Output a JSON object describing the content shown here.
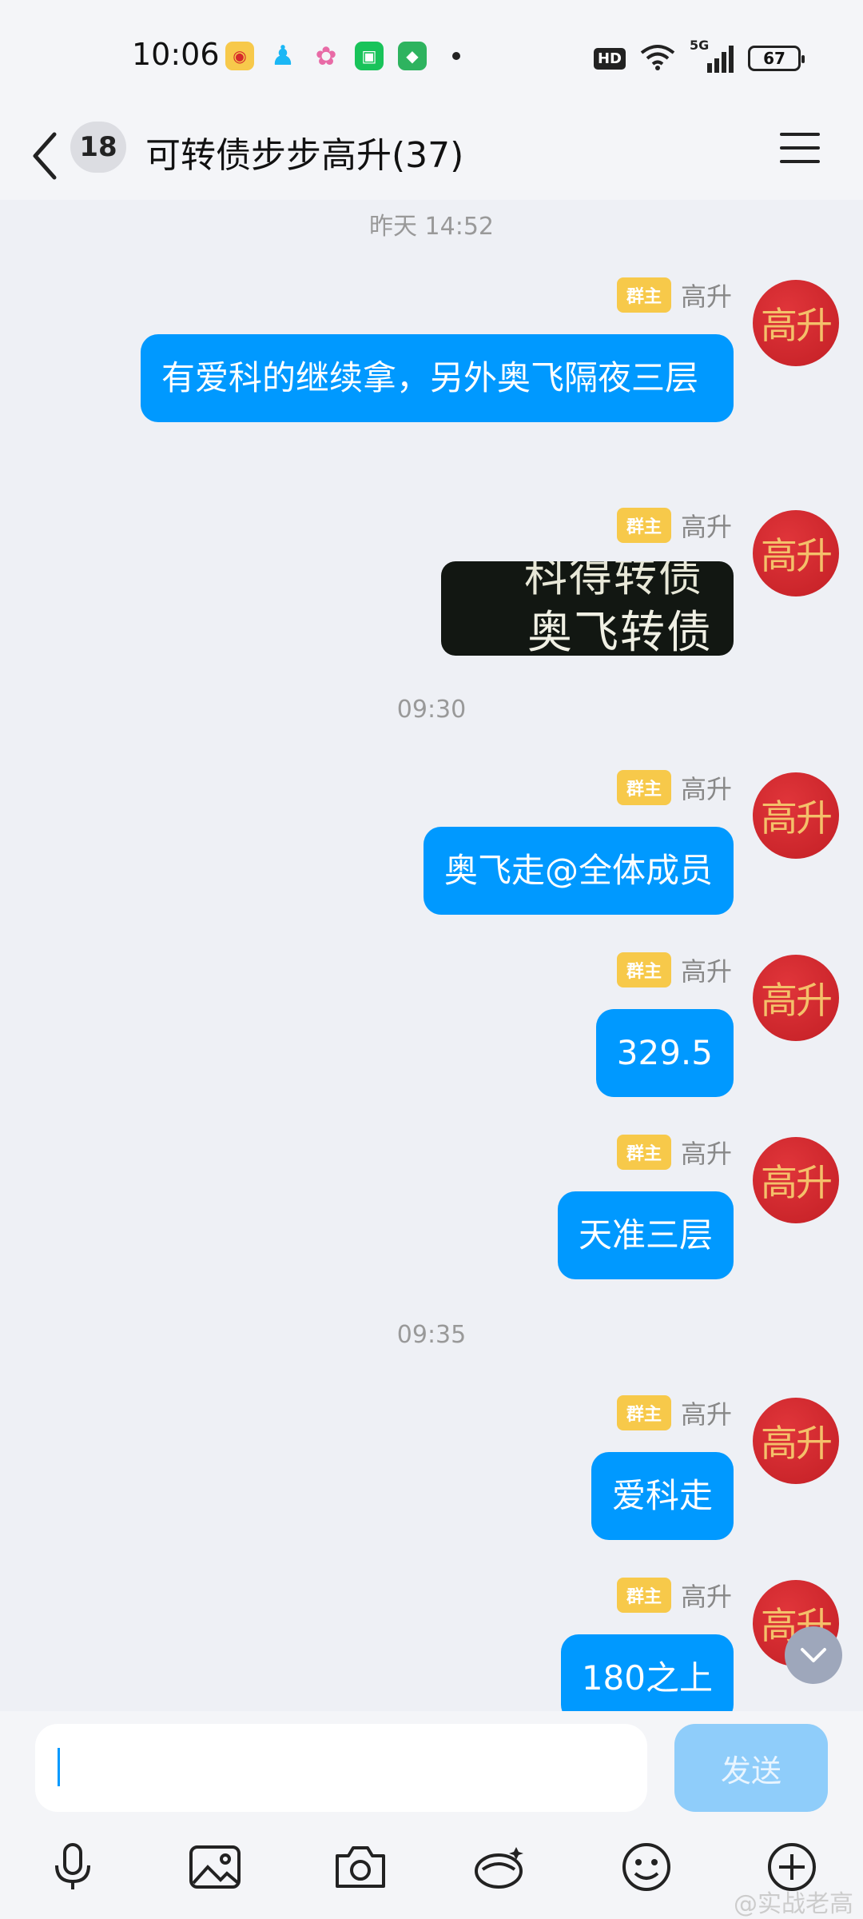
{
  "status_bar": {
    "time": "10:06",
    "hd_label": "HD",
    "signal_label": "5G",
    "battery_level": "67",
    "icons": [
      "weibo-icon",
      "qq-icon",
      "app-icon",
      "green-app-icon",
      "shield-icon",
      "notification-dot-icon",
      "wifi-icon",
      "signal-icon",
      "battery-icon"
    ]
  },
  "header": {
    "unread_count": "18",
    "title": "可转债步步高升(37)"
  },
  "chat": {
    "timestamps": [
      "昨天 14:52",
      "09:30",
      "09:35"
    ],
    "sender_role": "群主",
    "sender_name": "高升",
    "avatar_text": "高升",
    "messages": [
      {
        "type": "text",
        "text": "有爱科的继续拿，另外奥飞隔夜三层"
      },
      {
        "type": "image",
        "image_text_top": "科得转债",
        "image_text": "奥飞转债"
      },
      {
        "type": "text",
        "text": "奥飞走@全体成员"
      },
      {
        "type": "text",
        "text": "329.5"
      },
      {
        "type": "text",
        "text": "天准三层"
      },
      {
        "type": "text",
        "text": "爱科走"
      },
      {
        "type": "text",
        "text": "180之上"
      }
    ]
  },
  "input": {
    "placeholder": "",
    "send_label": "发送"
  },
  "toolbar": {
    "items": [
      "microphone-icon",
      "image-icon",
      "camera-icon",
      "red-packet-icon",
      "emoji-icon",
      "plus-icon"
    ]
  },
  "watermark": "@实战老高",
  "colors": {
    "bubble": "#0099ff",
    "badge": "#f7c94a",
    "avatar": "#c31f25",
    "send_disabled": "#8fcdfa"
  }
}
